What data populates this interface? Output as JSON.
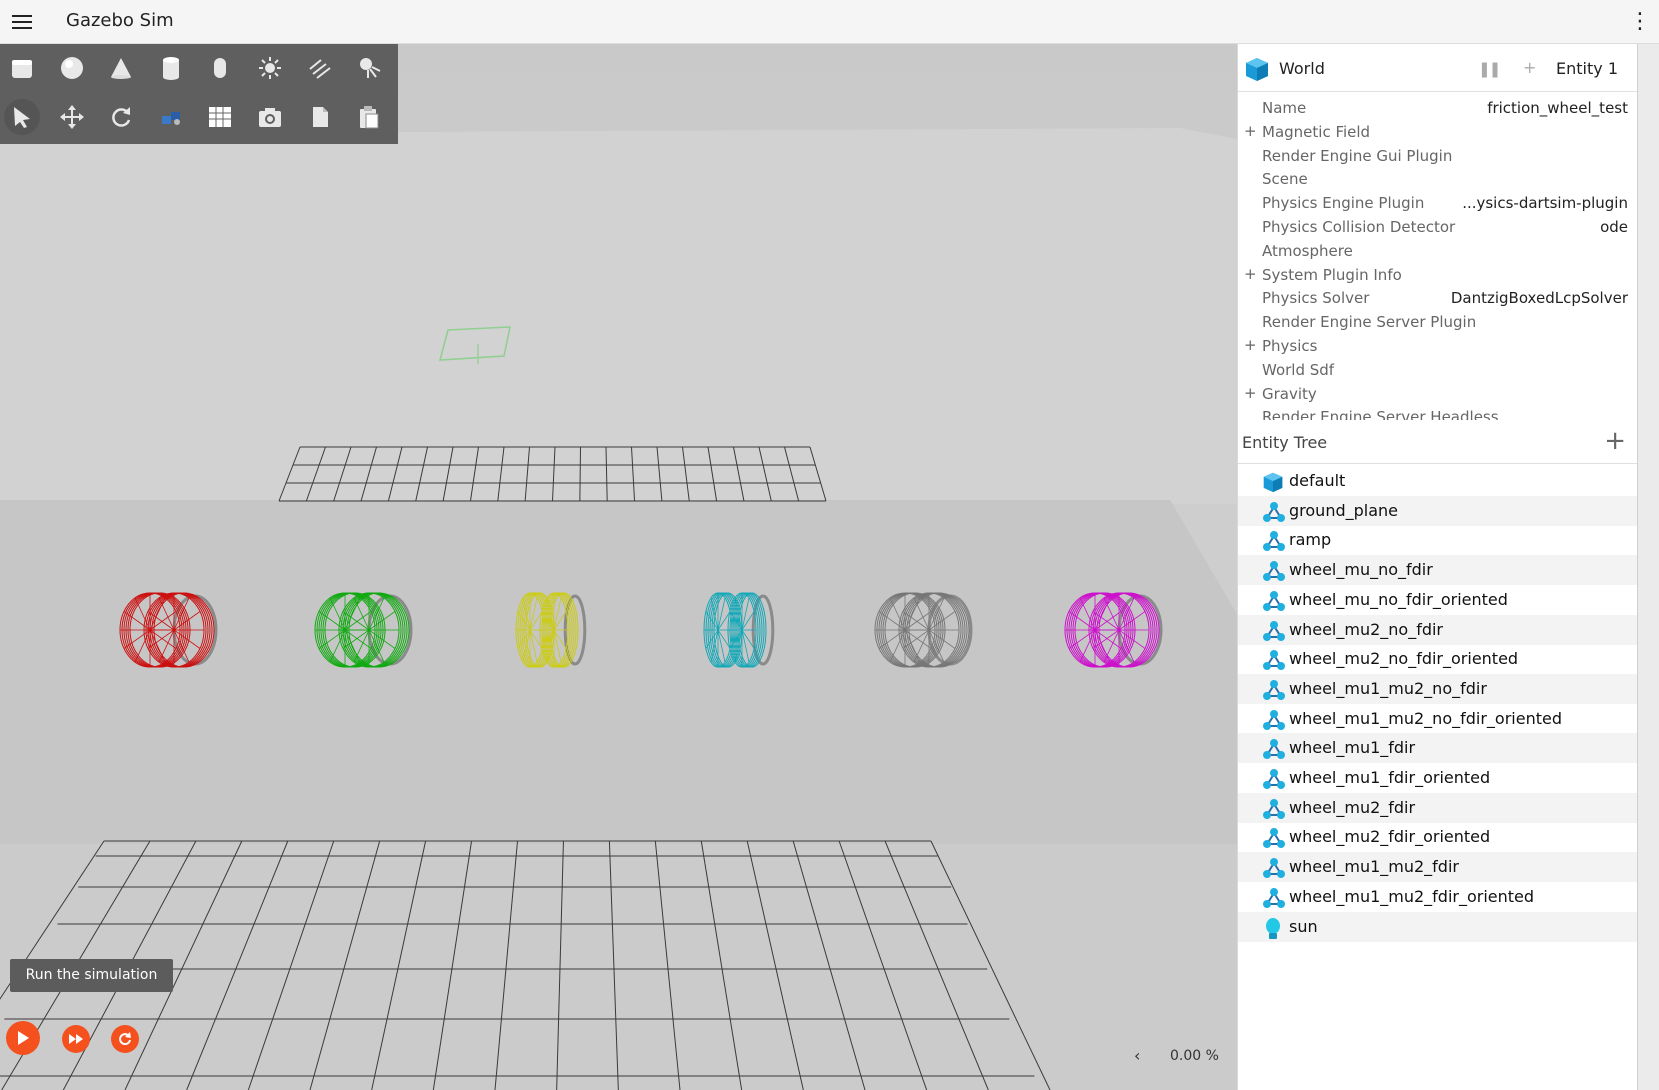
{
  "app": {
    "title": "Gazebo Sim"
  },
  "toolbar": {
    "shapes": [
      "box-icon",
      "sphere-icon",
      "cone-icon",
      "cylinder-icon",
      "capsule-icon",
      "point-light-icon",
      "directional-light-icon",
      "spot-light-icon"
    ],
    "tools": [
      "select-icon",
      "translate-icon",
      "rotate-icon",
      "transform-control-icon",
      "grid-config-icon",
      "screenshot-icon",
      "copy-icon",
      "paste-icon"
    ]
  },
  "simulation": {
    "tooltip": "Run the simulation",
    "play_icon": "play-icon",
    "step_icon": "fast-forward-icon",
    "reset_icon": "reset-icon",
    "rtf": "0.00 %",
    "collapse": "‹"
  },
  "component_inspector": {
    "title": "World",
    "entity": "Entity 1",
    "rows": [
      {
        "name": "Name",
        "value": "friction_wheel_test",
        "expandable": false
      },
      {
        "name": "Magnetic Field",
        "value": "",
        "expandable": true
      },
      {
        "name": "Render Engine Gui Plugin",
        "value": "",
        "expandable": false
      },
      {
        "name": "Scene",
        "value": "",
        "expandable": false
      },
      {
        "name": "Physics Engine Plugin",
        "value": "...ysics-dartsim-plugin",
        "expandable": false
      },
      {
        "name": "Physics Collision Detector",
        "value": "ode",
        "expandable": false
      },
      {
        "name": "Atmosphere",
        "value": "",
        "expandable": false
      },
      {
        "name": "System Plugin Info",
        "value": "",
        "expandable": true
      },
      {
        "name": "Physics Solver",
        "value": "DantzigBoxedLcpSolver",
        "expandable": false
      },
      {
        "name": "Render Engine Server Plugin",
        "value": "",
        "expandable": false
      },
      {
        "name": "Physics",
        "value": "",
        "expandable": true
      },
      {
        "name": "World Sdf",
        "value": "",
        "expandable": false
      },
      {
        "name": "Gravity",
        "value": "",
        "expandable": true
      },
      {
        "name": "Render Engine Server Headless",
        "value": "",
        "expandable": false
      }
    ]
  },
  "entity_tree": {
    "title": "Entity Tree",
    "add_label": "+",
    "items": [
      {
        "label": "default",
        "icon": "world-icon"
      },
      {
        "label": "ground_plane",
        "icon": "model-icon"
      },
      {
        "label": "ramp",
        "icon": "model-icon"
      },
      {
        "label": "wheel_mu_no_fdir",
        "icon": "model-icon"
      },
      {
        "label": "wheel_mu_no_fdir_oriented",
        "icon": "model-icon"
      },
      {
        "label": "wheel_mu2_no_fdir",
        "icon": "model-icon"
      },
      {
        "label": "wheel_mu2_no_fdir_oriented",
        "icon": "model-icon"
      },
      {
        "label": "wheel_mu1_mu2_no_fdir",
        "icon": "model-icon"
      },
      {
        "label": "wheel_mu1_mu2_no_fdir_oriented",
        "icon": "model-icon"
      },
      {
        "label": "wheel_mu1_fdir",
        "icon": "model-icon"
      },
      {
        "label": "wheel_mu1_fdir_oriented",
        "icon": "model-icon"
      },
      {
        "label": "wheel_mu2_fdir",
        "icon": "model-icon"
      },
      {
        "label": "wheel_mu2_fdir_oriented",
        "icon": "model-icon"
      },
      {
        "label": "wheel_mu1_mu2_fdir",
        "icon": "model-icon"
      },
      {
        "label": "wheel_mu1_mu2_fdir_oriented",
        "icon": "model-icon"
      },
      {
        "label": "sun",
        "icon": "light-bulb-icon"
      }
    ]
  },
  "colors": {
    "accent": "#f4511e",
    "wheel_red": "#cc1111",
    "wheel_green": "#11aa11",
    "wheel_yellow": "#cccc11",
    "wheel_cyan": "#11a8b8",
    "wheel_gray": "#777777",
    "wheel_magenta": "#cc11cc"
  }
}
